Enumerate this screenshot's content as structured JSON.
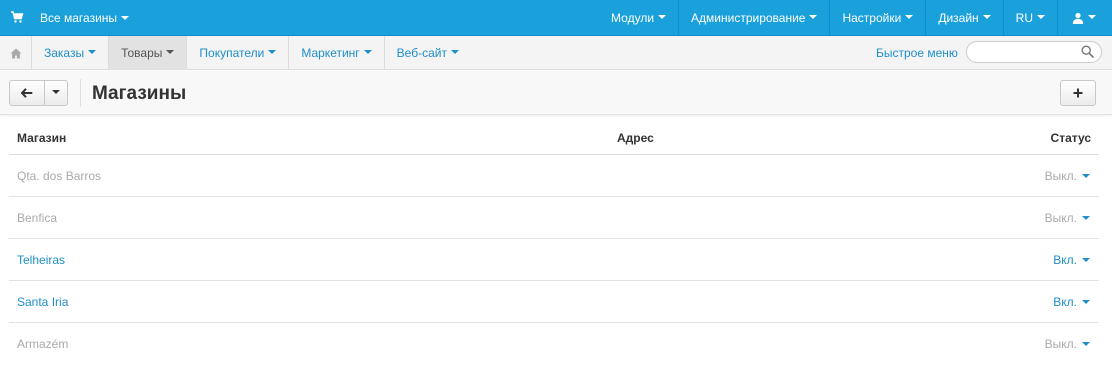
{
  "topbar": {
    "store_selector": "Все магазины",
    "nav": [
      {
        "label": "Модули"
      },
      {
        "label": "Администрирование"
      },
      {
        "label": "Настройки"
      },
      {
        "label": "Дизайн"
      },
      {
        "label": "RU"
      }
    ],
    "color": "#1aa1dc"
  },
  "subnav": {
    "tabs": [
      {
        "label": "Заказы"
      },
      {
        "label": "Товары"
      },
      {
        "label": "Покупатели"
      },
      {
        "label": "Маркетинг"
      },
      {
        "label": "Веб-сайт"
      }
    ],
    "active_tab": "Товары",
    "quick_menu": "Быстрое меню",
    "search_placeholder": ""
  },
  "toolbar": {
    "title": "Магазины",
    "add_label": "+"
  },
  "table": {
    "headers": {
      "store": "Магазин",
      "address": "Адрес",
      "status": "Статус"
    },
    "rows": [
      {
        "name": "Qta. dos Barros",
        "address": "",
        "status": "Выкл.",
        "enabled": false
      },
      {
        "name": "Benfica",
        "address": "",
        "status": "Выкл.",
        "enabled": false
      },
      {
        "name": "Telheiras",
        "address": "",
        "status": "Вкл.",
        "enabled": true
      },
      {
        "name": "Santa Iria",
        "address": "",
        "status": "Вкл.",
        "enabled": true
      },
      {
        "name": "Armazém",
        "address": "",
        "status": "Выкл.",
        "enabled": false
      }
    ]
  },
  "colors": {
    "link": "#1e8fca",
    "muted": "#aaaaaa"
  }
}
